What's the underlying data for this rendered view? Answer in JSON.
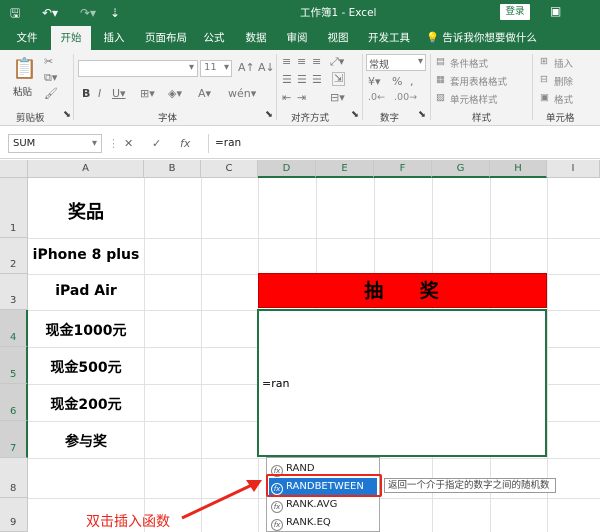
{
  "titlebar": {
    "title": "工作簿1 - Excel",
    "login_label": "登录"
  },
  "ribbon": {
    "tabs": [
      "文件",
      "开始",
      "插入",
      "页面布局",
      "公式",
      "数据",
      "审阅",
      "视图",
      "开发工具"
    ],
    "active_tab": "开始",
    "tell_me": "告诉我你想要做什么",
    "groups": {
      "clipboard": "剪贴板",
      "font": "字体",
      "alignment": "对齐方式",
      "number": "数字",
      "styles": "样式",
      "cells": "单元格"
    },
    "paste_label": "粘贴",
    "font_size": "11",
    "number_format": "常规",
    "styles_items": [
      "条件格式",
      "套用表格格式",
      "单元格样式"
    ],
    "cells_items": [
      "插入",
      "删除",
      "格式"
    ]
  },
  "formula_bar": {
    "name_box": "SUM",
    "formula": "=ran"
  },
  "grid": {
    "columns": [
      "A",
      "B",
      "C",
      "D",
      "E",
      "F",
      "G",
      "H",
      "I"
    ],
    "rows": [
      "1",
      "2",
      "3",
      "4",
      "5",
      "6",
      "7",
      "8",
      "9"
    ],
    "prize_header": "奖品",
    "prizes": [
      "iPhone 8 plus",
      "iPad Air",
      "现金1000元",
      "现金500元",
      "现金200元",
      "参与奖"
    ],
    "lottery_title": "抽    奖",
    "edit_text": "=ran"
  },
  "autocomplete": {
    "items": [
      "RAND",
      "RANDBETWEEN",
      "RANK.AVG",
      "RANK.EQ"
    ],
    "selected": "RANDBETWEEN",
    "tooltip": "返回一个介于指定的数字之间的随机数"
  },
  "annotation": {
    "text": "双击插入函数",
    "color": "#e8261b"
  },
  "colors": {
    "excel_green": "#217346",
    "lottery_red": "#ff0000",
    "selection_blue": "#1e78d2"
  }
}
